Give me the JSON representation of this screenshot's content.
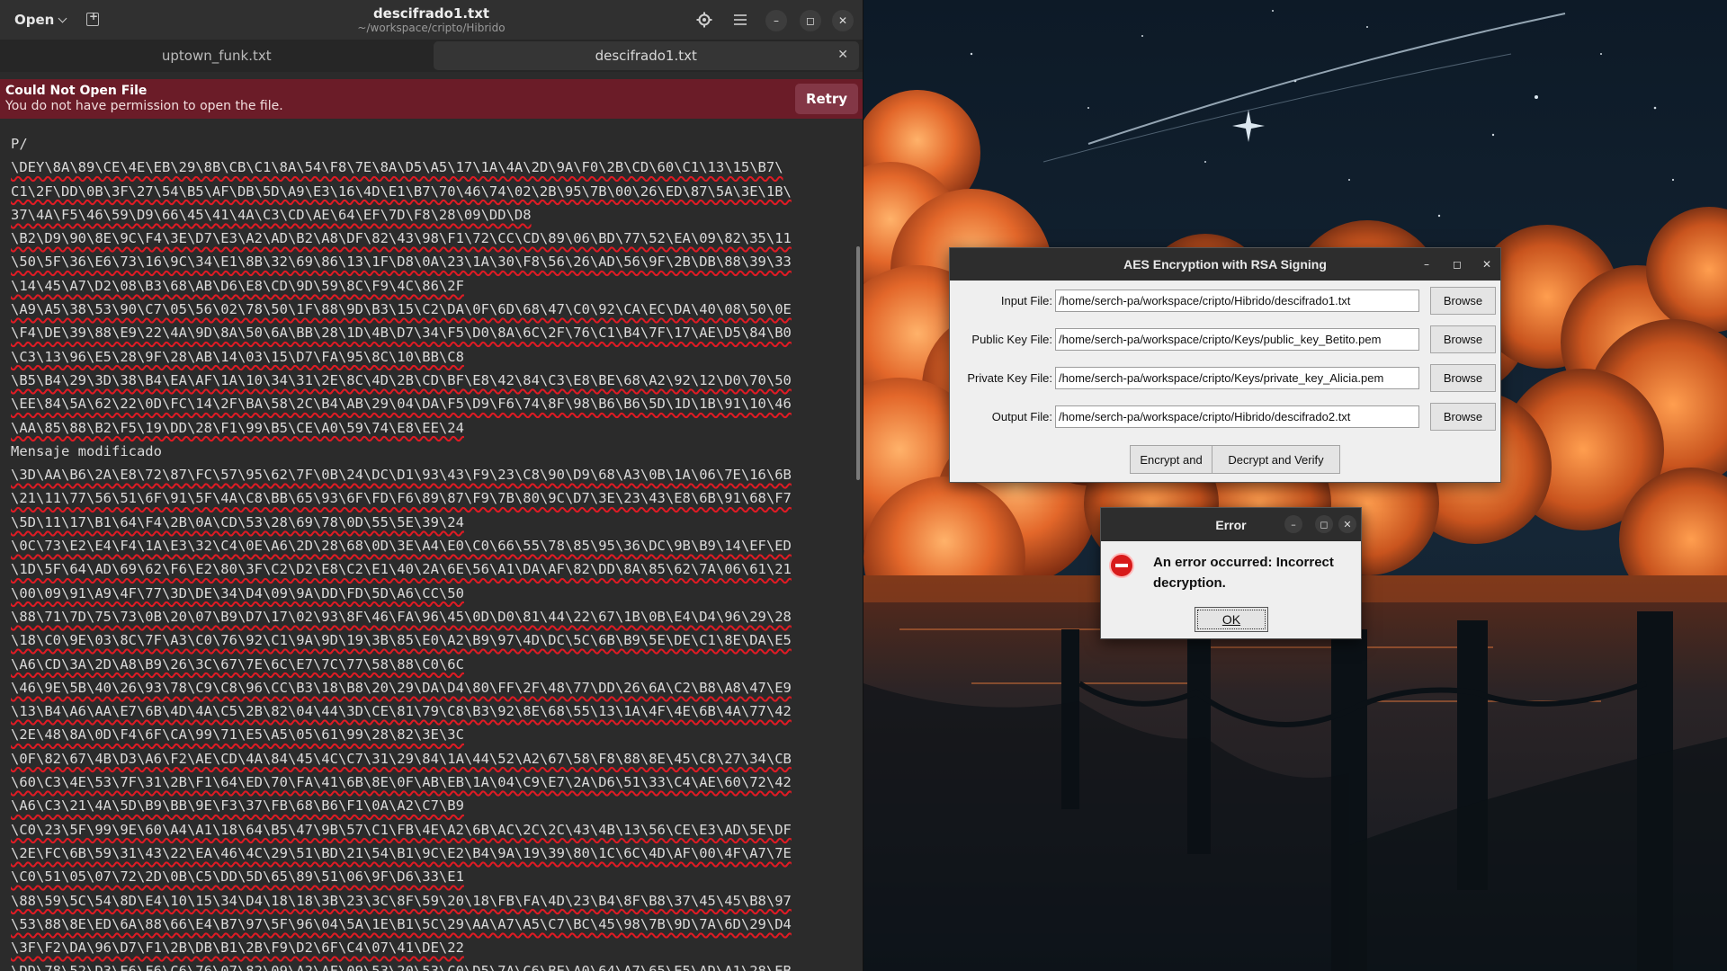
{
  "gedit": {
    "open_label": "Open",
    "title": "descifrado1.txt",
    "subtitle": "~/workspace/cripto/Hibrido",
    "tabs": [
      {
        "label": "uptown_funk.txt",
        "active": false
      },
      {
        "label": "descifrado1.txt",
        "active": true
      }
    ],
    "infobar": {
      "title": "Could Not Open File",
      "message": "You do not have permission to open the file.",
      "retry_label": "Retry"
    },
    "lines": [
      {
        "text": "P/",
        "error": false
      },
      {
        "text": "\\DEY\\8A\\89\\CE\\4E\\EB\\29\\8B\\CB\\C1\\8A\\54\\F8\\7E\\8A\\D5\\A5\\17\\1A\\4A\\2D\\9A\\F0\\2B\\CD\\60\\C1\\13\\15\\B7\\",
        "error": true
      },
      {
        "text": "C1\\2F\\DD\\0B\\3F\\27\\54\\B5\\AF\\DB\\5D\\A9\\E3\\16\\4D\\E1\\B7\\70\\46\\74\\02\\2B\\95\\7B\\00\\26\\ED\\87\\5A\\3E\\1B\\",
        "error": true
      },
      {
        "text": "37\\4A\\F5\\46\\59\\D9\\66\\45\\41\\4A\\C3\\CD\\AE\\64\\EF\\7D\\F8\\28\\09\\DD\\D8",
        "error": true
      },
      {
        "text": "\\B2\\D9\\90\\8E\\9C\\F4\\3E\\D7\\E3\\A2\\AD\\B2\\A8\\DF\\82\\43\\98\\F1\\72\\CC\\CD\\89\\06\\BD\\77\\52\\EA\\09\\82\\35\\11",
        "error": true
      },
      {
        "text": "\\50\\5F\\36\\E6\\73\\16\\9C\\34\\E1\\8B\\32\\69\\86\\13\\1F\\D8\\0A\\23\\1A\\30\\F8\\56\\26\\AD\\56\\9F\\2B\\DB\\88\\39\\33",
        "error": true
      },
      {
        "text": "\\14\\45\\A7\\D2\\08\\B3\\68\\AB\\D6\\E8\\CD\\9D\\59\\8C\\F9\\4C\\86\\2F",
        "error": true
      },
      {
        "text": "\\A9\\A5\\38\\53\\90\\C7\\05\\56\\02\\78\\50\\1F\\88\\9D\\B3\\15\\C2\\DA\\0F\\6D\\68\\47\\C0\\92\\CA\\EC\\DA\\40\\08\\50\\0E",
        "error": true
      },
      {
        "text": "\\F4\\DE\\39\\88\\E9\\22\\4A\\9D\\8A\\50\\6A\\BB\\28\\1D\\4B\\D7\\34\\F5\\D0\\8A\\6C\\2F\\76\\C1\\B4\\7F\\17\\AE\\D5\\84\\B0",
        "error": true
      },
      {
        "text": "\\C3\\13\\96\\E5\\28\\9F\\28\\AB\\14\\03\\15\\D7\\FA\\95\\8C\\10\\BB\\C8",
        "error": true
      },
      {
        "text": "\\B5\\B4\\29\\3D\\38\\B4\\EA\\AF\\1A\\10\\34\\31\\2E\\8C\\4D\\2B\\CD\\BF\\E8\\42\\84\\C3\\E8\\BE\\68\\A2\\92\\12\\D0\\70\\50",
        "error": true
      },
      {
        "text": "\\EE\\84\\5A\\62\\22\\0D\\FC\\14\\2F\\BA\\58\\2C\\B4\\AB\\29\\04\\DA\\F5\\D9\\F6\\74\\8F\\98\\B6\\B6\\5D\\1D\\1B\\91\\10\\46",
        "error": true
      },
      {
        "text": "\\AA\\85\\88\\B2\\F5\\19\\DD\\28\\F1\\99\\B5\\CE\\A0\\59\\74\\E8\\EE\\24",
        "error": true
      },
      {
        "text": "Mensaje modificado",
        "error": false
      },
      {
        "text": "\\3D\\AA\\B6\\2A\\E8\\72\\87\\FC\\57\\95\\62\\7F\\0B\\24\\DC\\D1\\93\\43\\F9\\23\\C8\\90\\D9\\68\\A3\\0B\\1A\\06\\7E\\16\\6B",
        "error": true
      },
      {
        "text": "\\21\\11\\77\\56\\51\\6F\\91\\5F\\4A\\C8\\BB\\65\\93\\6F\\FD\\F6\\89\\87\\F9\\7B\\80\\9C\\D7\\3E\\23\\43\\E8\\6B\\91\\68\\F7",
        "error": true
      },
      {
        "text": "\\5D\\11\\17\\B1\\64\\F4\\2B\\0A\\CD\\53\\28\\69\\78\\0D\\55\\5E\\39\\24",
        "error": true
      },
      {
        "text": "\\0C\\73\\E2\\E4\\F4\\1A\\E3\\32\\C4\\0E\\A6\\2D\\28\\68\\0D\\3E\\A4\\E0\\C0\\66\\55\\78\\85\\95\\36\\DC\\9B\\B9\\14\\EF\\ED",
        "error": true
      },
      {
        "text": "\\1D\\5F\\64\\AD\\69\\62\\F6\\E2\\80\\3F\\C2\\D2\\E8\\C2\\E1\\40\\2A\\6E\\56\\A1\\DA\\AF\\82\\DD\\8A\\85\\62\\7A\\06\\61\\21",
        "error": true
      },
      {
        "text": "\\00\\09\\91\\A9\\4F\\77\\3D\\DE\\34\\D4\\09\\9A\\DD\\FD\\5D\\A6\\CC\\50",
        "error": true
      },
      {
        "text": "\\88\\71\\7D\\75\\73\\0B\\20\\07\\B9\\D7\\17\\02\\93\\8F\\46\\FA\\96\\45\\0D\\D0\\81\\44\\22\\67\\1B\\0B\\E4\\D4\\96\\29\\28",
        "error": true
      },
      {
        "text": "\\18\\C0\\9E\\03\\8C\\7F\\A3\\C0\\76\\92\\C1\\9A\\9D\\19\\3B\\85\\E0\\A2\\B9\\97\\4D\\DC\\5C\\6B\\B9\\5E\\DE\\C1\\8E\\DA\\E5",
        "error": true
      },
      {
        "text": "\\A6\\CD\\3A\\2D\\A8\\B9\\26\\3C\\67\\7E\\6C\\E7\\7C\\77\\58\\88\\C0\\6C",
        "error": true
      },
      {
        "text": "\\46\\9E\\5B\\40\\26\\93\\78\\C9\\C8\\96\\CC\\B3\\18\\B8\\20\\29\\DA\\D4\\80\\FF\\2F\\48\\77\\DD\\26\\6A\\C2\\B8\\A8\\47\\E9",
        "error": true
      },
      {
        "text": "\\13\\B4\\A6\\AA\\E7\\6B\\4D\\4A\\C5\\2B\\82\\04\\44\\3D\\CE\\81\\79\\C8\\B3\\92\\8E\\68\\55\\13\\1A\\4F\\4E\\6B\\4A\\77\\42",
        "error": true
      },
      {
        "text": "\\2E\\48\\8A\\0D\\F4\\6F\\CA\\99\\71\\E5\\A5\\05\\61\\99\\28\\82\\3E\\3C",
        "error": true
      },
      {
        "text": "\\0F\\82\\67\\4B\\D3\\A6\\F2\\AE\\CD\\4A\\84\\45\\4C\\C7\\31\\29\\84\\1A\\44\\52\\A2\\67\\58\\F8\\88\\8E\\45\\C8\\27\\34\\CB",
        "error": true
      },
      {
        "text": "\\60\\C3\\4E\\53\\7F\\31\\2B\\F1\\64\\ED\\70\\FA\\41\\6B\\8E\\0F\\AB\\EB\\1A\\04\\C9\\E7\\2A\\D6\\51\\33\\C4\\AE\\60\\72\\42",
        "error": true
      },
      {
        "text": "\\A6\\C3\\21\\4A\\5D\\B9\\BB\\9E\\F3\\37\\FB\\68\\B6\\F1\\0A\\A2\\C7\\B9",
        "error": true
      },
      {
        "text": "\\C0\\23\\5F\\99\\9E\\60\\A4\\A1\\18\\64\\B5\\47\\9B\\57\\C1\\FB\\4E\\A2\\6B\\AC\\2C\\2C\\43\\4B\\13\\56\\CE\\E3\\AD\\5E\\DF",
        "error": true
      },
      {
        "text": "\\2E\\FC\\6B\\59\\31\\43\\22\\EA\\46\\4C\\29\\51\\BD\\21\\54\\B1\\9C\\E2\\B4\\9A\\19\\39\\80\\1C\\6C\\4D\\AF\\00\\4F\\A7\\7E",
        "error": true
      },
      {
        "text": "\\C0\\51\\05\\07\\72\\2D\\0B\\C5\\DD\\5D\\65\\89\\51\\06\\9F\\D6\\33\\E1",
        "error": true
      },
      {
        "text": "\\88\\59\\5C\\54\\8D\\E4\\10\\15\\34\\D4\\18\\18\\3B\\23\\3C\\8F\\59\\20\\18\\FB\\FA\\4D\\23\\B4\\8F\\B8\\37\\45\\45\\B8\\97",
        "error": true
      },
      {
        "text": "\\53\\88\\8E\\ED\\6A\\88\\66\\E4\\B7\\97\\5F\\96\\04\\5A\\1E\\B1\\5C\\29\\AA\\A7\\A5\\C7\\BC\\45\\98\\7B\\9D\\7A\\6D\\29\\D4",
        "error": true
      },
      {
        "text": "\\3F\\F2\\DA\\96\\D7\\F1\\2B\\DB\\B1\\2B\\F9\\D2\\6F\\C4\\07\\41\\DE\\22",
        "error": true
      },
      {
        "text": "\\DD\\78\\52\\D3\\E6\\F6\\C6\\76\\07\\82\\09\\A2\\AF\\09\\53\\20\\53\\C0\\D5\\7A\\C6\\BE\\A0\\64\\A7\\65\\E5\\AD\\A1\\28\\EB",
        "error": true
      }
    ]
  },
  "aes_window": {
    "title": "AES Encryption with RSA Signing",
    "fields": [
      {
        "label": "Input File:",
        "value": "/home/serch-pa/workspace/cripto/Hibrido/descifrado1.txt",
        "button": "Browse"
      },
      {
        "label": "Public Key File:",
        "value": "/home/serch-pa/workspace/cripto/Keys/public_key_Betito.pem",
        "button": "Browse"
      },
      {
        "label": "Private Key File:",
        "value": "/home/serch-pa/workspace/cripto/Keys/private_key_Alicia.pem",
        "button": "Browse"
      },
      {
        "label": "Output File:",
        "value": "/home/serch-pa/workspace/cripto/Hibrido/descifrado2.txt",
        "button": "Browse"
      }
    ],
    "encrypt_label": "Encrypt and",
    "decrypt_label": "Decrypt and Verify"
  },
  "error_dialog": {
    "title": "Error",
    "message": "An error occurred: Incorrect decryption.",
    "ok_label": "OK"
  },
  "colors": {
    "infobar": "#6b1c28",
    "retry": "#833746",
    "error_underline": "#e01b24",
    "editor_bg": "#2b2b2b"
  }
}
